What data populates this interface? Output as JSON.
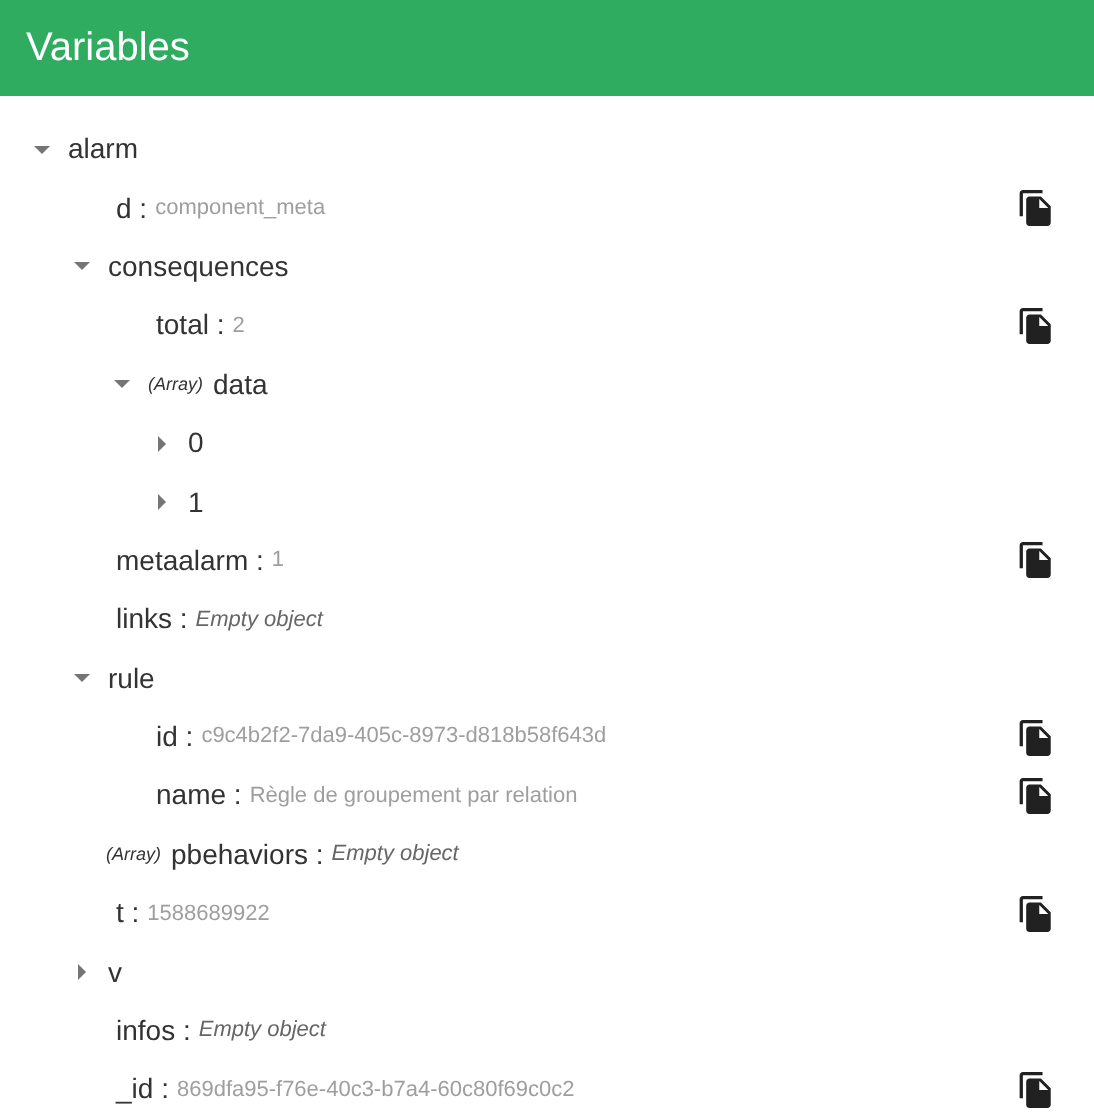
{
  "header": {
    "title": "Variables"
  },
  "tree": [
    {
      "key": "alarm",
      "expanded": true,
      "children": [
        {
          "key": "d",
          "sep": ":",
          "value": "component_meta",
          "kind": "value",
          "copyable": true
        },
        {
          "key": "consequences",
          "expanded": true,
          "children": [
            {
              "key": "total",
              "sep": ":",
              "value": "2",
              "kind": "value",
              "copyable": true
            },
            {
              "key": "data",
              "tag": "(Array)",
              "expanded": true,
              "children": [
                {
                  "key": "0",
                  "expanded": false
                },
                {
                  "key": "1",
                  "expanded": false
                }
              ]
            }
          ]
        },
        {
          "key": "metaalarm",
          "sep": ":",
          "value": "1",
          "kind": "value",
          "copyable": true
        },
        {
          "key": "links",
          "sep": ":",
          "value": "Empty object",
          "kind": "note",
          "copyable": false
        },
        {
          "key": "rule",
          "expanded": true,
          "children": [
            {
              "key": "id",
              "sep": ":",
              "value": "c9c4b2f2-7da9-405c-8973-d818b58f643d",
              "kind": "value",
              "copyable": true
            },
            {
              "key": "name",
              "sep": ":",
              "value": "Règle de groupement par relation",
              "kind": "value",
              "copyable": true
            }
          ]
        },
        {
          "key": "pbehaviors",
          "tag": "(Array)",
          "sep": ":",
          "value": "Empty object",
          "kind": "note",
          "copyable": false
        },
        {
          "key": "t",
          "sep": ":",
          "value": "1588689922",
          "kind": "value",
          "copyable": true
        },
        {
          "key": "v",
          "expanded": false
        },
        {
          "key": "infos",
          "sep": ":",
          "value": "Empty object",
          "kind": "note",
          "copyable": false
        },
        {
          "key": "_id",
          "sep": ":",
          "value": "869dfa95-f76e-40c3-b7a4-60c80f69c0c2",
          "kind": "value",
          "copyable": true
        }
      ]
    }
  ]
}
